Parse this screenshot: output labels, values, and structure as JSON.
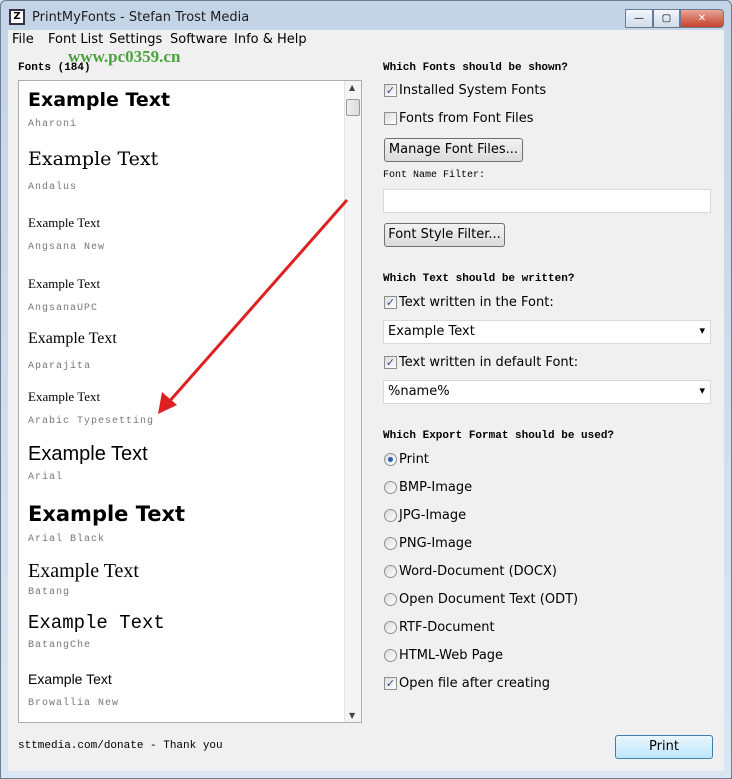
{
  "window": {
    "title": "PrintMyFonts - Stefan Trost Media",
    "min": "—",
    "max": "▢",
    "close": "✕"
  },
  "menu": [
    "File",
    "Font List",
    "Settings",
    "Software",
    "Info & Help"
  ],
  "watermark": "www.pc0359.cn",
  "fonts_list": {
    "header": "Fonts (184)",
    "example_text": "Example Text",
    "items": [
      "Aharoni",
      "Andalus",
      "Angsana New",
      "AngsanaUPC",
      "Aparajita",
      "Arabic Typesetting",
      "Arial",
      "Arial Black",
      "Batang",
      "BatangChe",
      "Browallia New"
    ]
  },
  "shown": {
    "heading": "Which Fonts should be shown?",
    "installed": "Installed System Fonts",
    "installed_checked": true,
    "from_files": "Fonts from Font Files",
    "from_files_checked": false,
    "manage_btn": "Manage Font Files...",
    "filter_label": "Font Name Filter:",
    "filter_value": "",
    "style_btn": "Font Style Filter..."
  },
  "text": {
    "heading": "Which Text should be written?",
    "in_font": "Text written in the Font:",
    "in_font_checked": true,
    "in_font_value": "Example Text",
    "default_font": "Text written in default Font:",
    "default_checked": true,
    "default_value": "%name%"
  },
  "export": {
    "heading": "Which Export Format should be used?",
    "options": [
      "Print",
      "BMP-Image",
      "JPG-Image",
      "PNG-Image",
      "Word-Document (DOCX)",
      "Open Document Text (ODT)",
      "RTF-Document",
      "HTML-Web Page"
    ],
    "selected": "Print",
    "open_after": "Open file after creating",
    "open_after_checked": true
  },
  "footer": {
    "donate": "sttmedia.com/donate - Thank you",
    "print_btn": "Print"
  },
  "annotation_color": "#e02020"
}
